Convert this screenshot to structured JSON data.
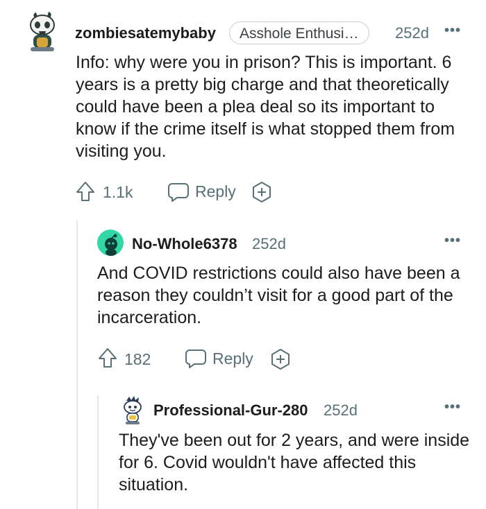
{
  "comments": [
    {
      "username": "zombiesatemybaby",
      "flair": "Asshole Enthusi…",
      "age": "252d",
      "body": "Info: why were you in prison? This is important. 6 years is a pretty big charge and that theoretically could have been a plea deal so its important to know if the crime itself is what stopped them from visiting you.",
      "score": "1.1k",
      "reply_label": "Reply",
      "avatar_icon": "skull-snoo-avatar-icon"
    },
    {
      "username": "No-Whole6378",
      "age": "252d",
      "body": "And COVID restrictions could also have been a reason they couldn’t visit for a good part of the incarceration.",
      "score": "182",
      "reply_label": "Reply",
      "avatar_icon": "default-snoo-avatar-icon"
    },
    {
      "username": "Professional-Gur-280",
      "age": "252d",
      "body": "They've been out for 2 years, and were inside for 6. Covid wouldn't have affected this situation.",
      "avatar_icon": "snoo-avatar-icon"
    }
  ],
  "more_glyph": "•••",
  "colors": {
    "text": "#1c1c1c",
    "meta": "#576f76",
    "thread_line": "#e5e8ea",
    "avatar_teal": "#33d6a6"
  }
}
